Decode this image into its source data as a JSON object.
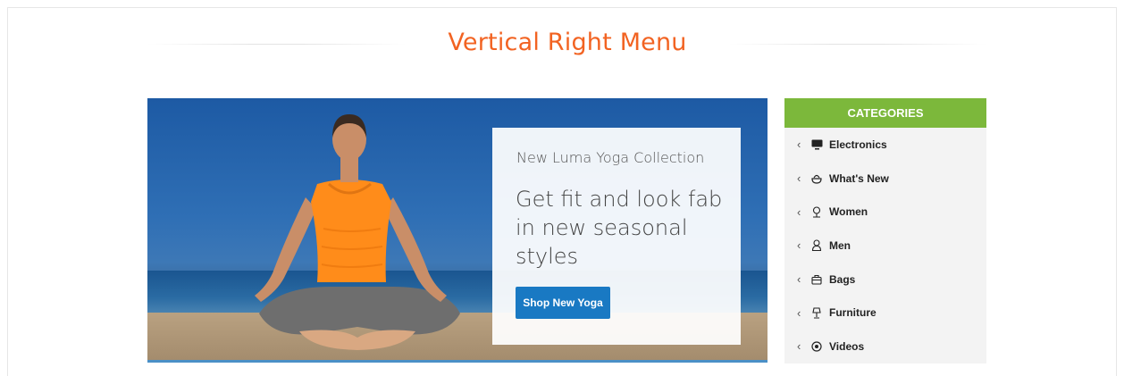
{
  "title": "Vertical Right Menu",
  "banner": {
    "kicker": "New Luma Yoga Collection",
    "headline": "Get fit and look fab in new seasonal styles",
    "cta_label": "Shop New Yoga",
    "cta_color": "#1979c3"
  },
  "sidebar": {
    "header": "CATEGORIES",
    "header_color": "#7cb83b",
    "items": [
      {
        "label": "Electronics",
        "icon": "monitor-icon"
      },
      {
        "label": "What's New",
        "icon": "bowl-icon"
      },
      {
        "label": "Women",
        "icon": "woman-icon"
      },
      {
        "label": "Men",
        "icon": "man-icon"
      },
      {
        "label": "Bags",
        "icon": "bag-icon"
      },
      {
        "label": "Furniture",
        "icon": "lamp-icon"
      },
      {
        "label": "Videos",
        "icon": "play-circle-icon"
      }
    ]
  },
  "accent_color": "#f26322"
}
